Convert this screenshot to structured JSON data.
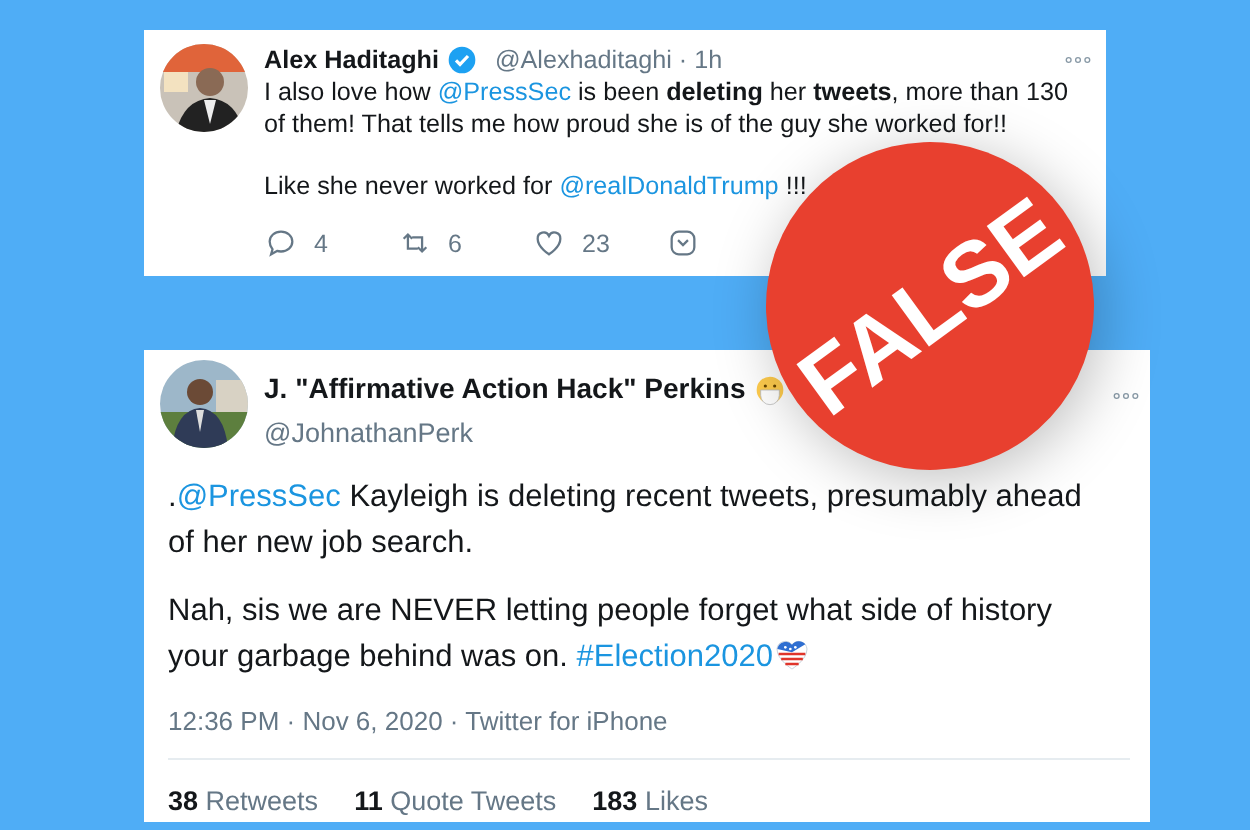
{
  "tweets": [
    {
      "kind": "compact",
      "name": "Alex Haditaghi",
      "verified": true,
      "handle_line": "@Alexhaditaghi · 1h",
      "paragraphs": [
        [
          {
            "kind": "plain",
            "text": "I also love how "
          },
          {
            "kind": "mention",
            "text": "@PressSec"
          },
          {
            "kind": "plain",
            "text": " is been **deleting** her **tweets**, more than 130 of them! That tells me how proud she is of the guy she worked for!!"
          }
        ],
        [
          {
            "kind": "plain",
            "text": "Like she never worked for "
          },
          {
            "kind": "mention",
            "text": "@realDonaldTrump"
          },
          {
            "kind": "plain",
            "text": " !!!"
          }
        ]
      ],
      "actions": [
        {
          "kind": "reply",
          "count": "4"
        },
        {
          "kind": "retweet",
          "count": "6"
        },
        {
          "kind": "like",
          "count": "23"
        },
        {
          "kind": "share"
        }
      ]
    },
    {
      "kind": "detail",
      "name": "J. \"Affirmative Action Hack\" Perkins",
      "mask_emoji": true,
      "verified": false,
      "handle_line": "@JohnathanPerk",
      "paragraphs": [
        [
          {
            "kind": "plain",
            "text": "."
          },
          {
            "kind": "mention",
            "text": "@PressSec"
          },
          {
            "kind": "plain",
            "text": " Kayleigh is deleting recent tweets, presumably ahead of her new job search."
          }
        ],
        [
          {
            "kind": "plain",
            "text": "Nah, sis we are NEVER letting people forget what side of history your garbage behind was on. "
          },
          {
            "kind": "mention",
            "text": "#Election2020"
          },
          {
            "kind": "emoji"
          }
        ]
      ],
      "meta": "12:36 PM · Nov 6, 2020 · Twitter for iPhone",
      "stats": [
        "**38** Retweets",
        "**11** Quote Tweets",
        "**183** Likes"
      ]
    }
  ],
  "stamp": {
    "text": "FALSE"
  }
}
